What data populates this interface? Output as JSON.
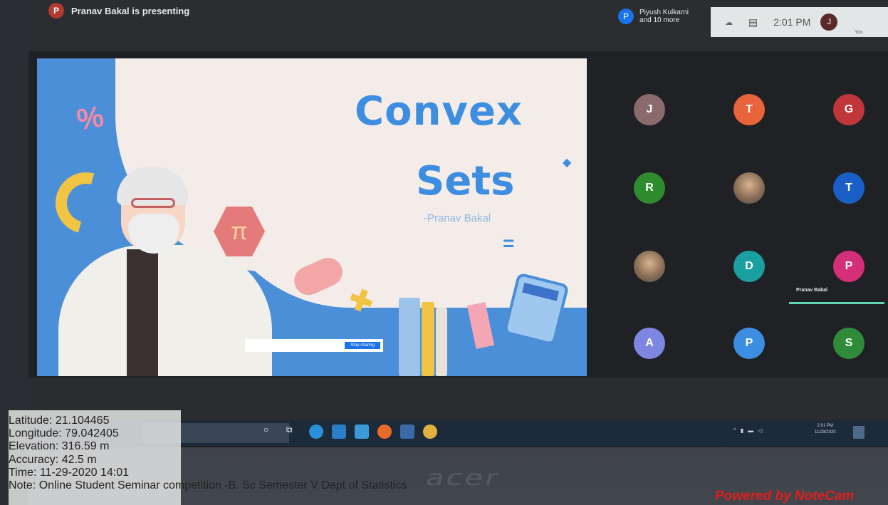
{
  "meet": {
    "presenting_text": "Pranav Bakal is presenting",
    "presenter_initial": "P",
    "people_initial": "P",
    "people_line1": "Piyush Kulkarni",
    "people_line2": "and 10 more",
    "clock": "2:01 PM",
    "self_initial": "J",
    "self_label": "You",
    "speaker_name": "Pranav Bakal"
  },
  "slide": {
    "title_line1": "Convex",
    "title_line2": "Sets",
    "author": "-Pranav Bakal",
    "stop_sharing": "Stop sharing",
    "pi_symbol": "π",
    "percent_symbol": "%",
    "equals_symbol": "="
  },
  "participants": [
    {
      "initial": "J",
      "color": "#8a6a6a"
    },
    {
      "initial": "T",
      "color": "#e8643a"
    },
    {
      "initial": "G",
      "color": "#c0363b"
    },
    {
      "initial": "R",
      "color": "#2e8b2e"
    },
    {
      "initial": "",
      "color": "photo"
    },
    {
      "initial": "T",
      "color": "#1a5fc8"
    },
    {
      "initial": "",
      "color": "photo"
    },
    {
      "initial": "D",
      "color": "#1aa0a0"
    },
    {
      "initial": "P",
      "color": "#d62f7a"
    },
    {
      "initial": "A",
      "color": "#7d86e0"
    },
    {
      "initial": "P",
      "color": "#3b8ee0"
    },
    {
      "initial": "S",
      "color": "#2f8a3a"
    }
  ],
  "taskbar": {
    "tray_time": "2:01 PM",
    "tray_date": "11/29/2020"
  },
  "monitor_brand": "acer",
  "notecam": {
    "latitude": "Latitude: 21.104465",
    "longitude": "Longitude: 79.042405",
    "elevation": "Elevation: 316.59 m",
    "accuracy": "Accuracy: 42.5 m",
    "time": "Time: 11-29-2020 14:01",
    "note": "Note: Online  Student Seminar competition -B. Sc Semester V Dept of Statistics",
    "powered": "Powered by NoteCam"
  }
}
